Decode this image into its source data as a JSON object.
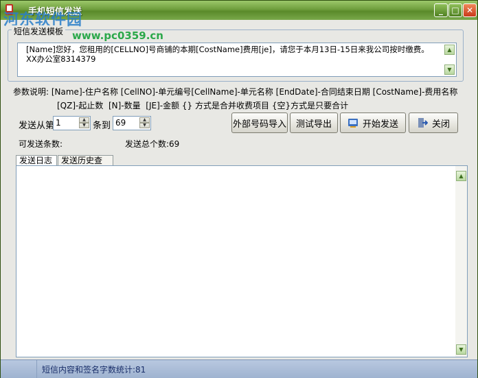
{
  "window": {
    "title": "手机短信发送"
  },
  "watermark": {
    "text": "河东软件园",
    "site": "www.pc0359.cn"
  },
  "template": {
    "group_label": "短信发送模板",
    "text": "[Name]您好，您租用的[CELLNO]号商铺的本期[CostName]费用[je]，请您于本月13日-15日来我公司按时缴费。XX办公室8314379"
  },
  "params": {
    "line1": "参数说明: [Name]-住户名称 [CellNO]-单元编号[CellName]-单元名称 [EndDate]-合同结束日期 [CostName]-费用名称",
    "line2": "[QZ]-起止数  [N]-数量  [JE]-金额 {} 方式是合并收费项目 {空}方式是只要合计"
  },
  "range": {
    "from_label": "发送从第",
    "from_value": "1",
    "to_label": "条到",
    "to_value": "69"
  },
  "buttons": {
    "import": "外部号码导入",
    "test_export": "测试导出",
    "start": "开始发送",
    "close": "关闭"
  },
  "info": {
    "sendable": "可发送条数:",
    "total": "发送总个数:69"
  },
  "tabs": [
    "发送日志",
    "发送历史查询"
  ],
  "status": {
    "text": "短信内容和签名字数统计:81"
  },
  "icons": {
    "title_min": "minimize-icon",
    "title_max": "maximize-icon",
    "title_close": "close-icon",
    "start_button": "send-icon",
    "close_button": "exit-door-icon"
  }
}
